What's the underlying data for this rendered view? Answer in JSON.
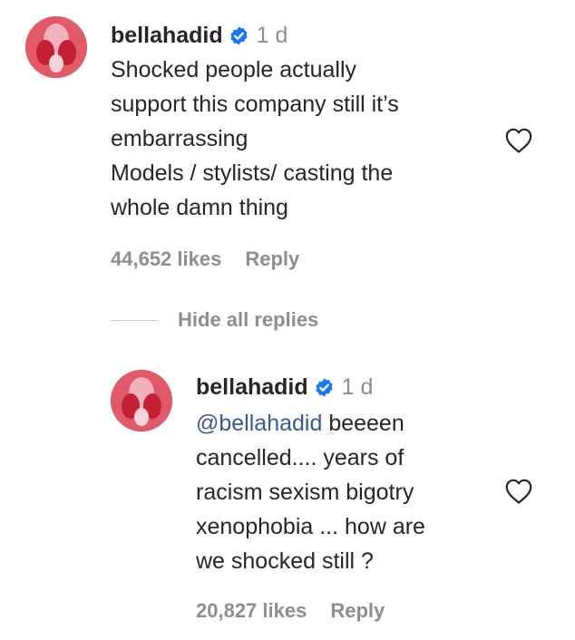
{
  "colors": {
    "text": "#262626",
    "secondary": "#8e8e8e",
    "mention": "#385898",
    "verified_badge": "#1877f2"
  },
  "comment": {
    "username": "bellahadid",
    "verified_icon": "verified-badge-icon",
    "time": "1 d",
    "lines": [
      "Shocked people actually",
      "support this company still it’s",
      "embarrassing",
      "Models / stylists/ casting the",
      "whole damn thing"
    ],
    "likes": "44,652 likes",
    "reply_label": "Reply",
    "like_icon": "heart-icon"
  },
  "hide_replies_label": "Hide all replies",
  "reply": {
    "username": "bellahadid",
    "verified_icon": "verified-badge-icon",
    "time": "1 d",
    "mention": "@bellahadid",
    "first_line_rest": " beeeen",
    "lines": [
      "cancelled.... years of",
      "racism sexism bigotry",
      "xenophobia ... how are",
      "we shocked still ?"
    ],
    "likes": "20,827 likes",
    "reply_label": "Reply",
    "like_icon": "heart-icon"
  }
}
